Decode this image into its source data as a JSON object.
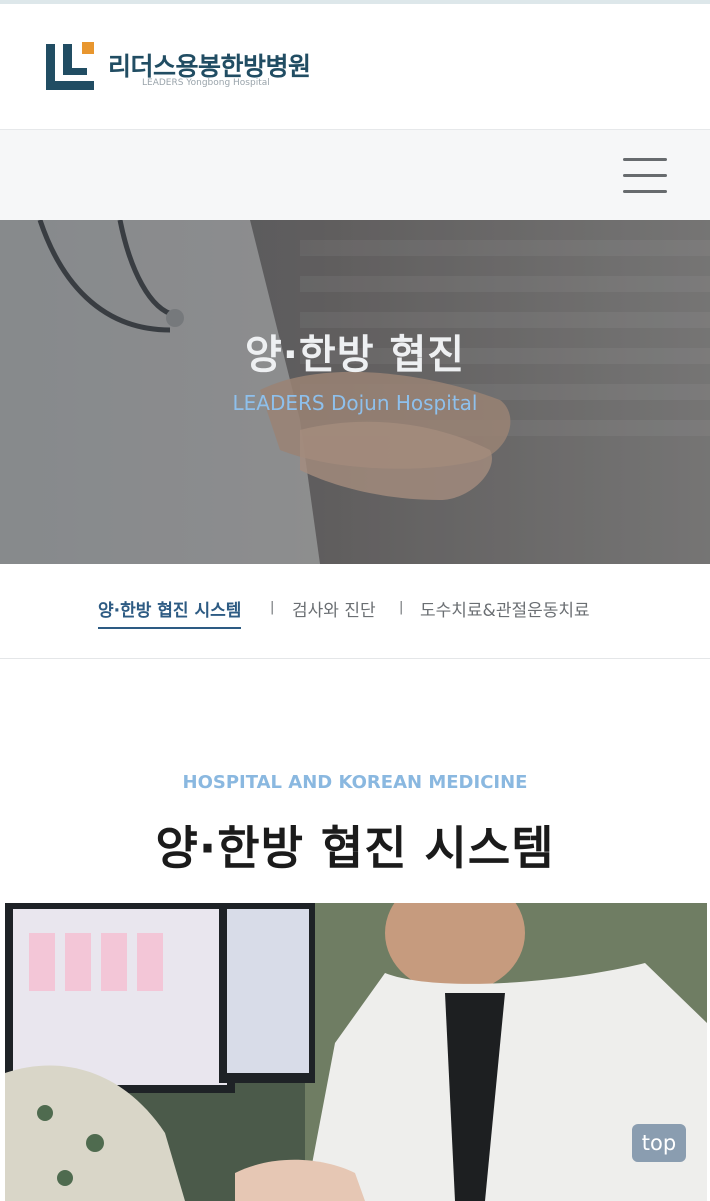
{
  "header": {
    "logo_title": "리더스용봉한방병원",
    "logo_subtitle": "LEADERS Yongbong Hospital",
    "logo_icon": "leaders-logo-mark"
  },
  "menu": {
    "icon": "hamburger-menu-icon"
  },
  "hero": {
    "title": "양·한방 협진",
    "subtitle": "LEADERS Dojun Hospital"
  },
  "tabs": [
    {
      "label": "양·한방 협진 시스템",
      "active": true
    },
    {
      "label": "검사와 진단",
      "active": false
    },
    {
      "label": "도수치료&관절운동치료",
      "active": false
    }
  ],
  "tab_separator": "|",
  "section": {
    "eyebrow": "HOSPITAL AND KOREAN MEDICINE",
    "title": "양·한방 협진 시스템"
  },
  "top_button": "top",
  "colors": {
    "brand_navy": "#214d63",
    "brand_orange": "#e8962e",
    "tab_active": "#2d5b83",
    "hero_subtitle": "#8ec0ec",
    "eyebrow": "#8ab8e0"
  }
}
